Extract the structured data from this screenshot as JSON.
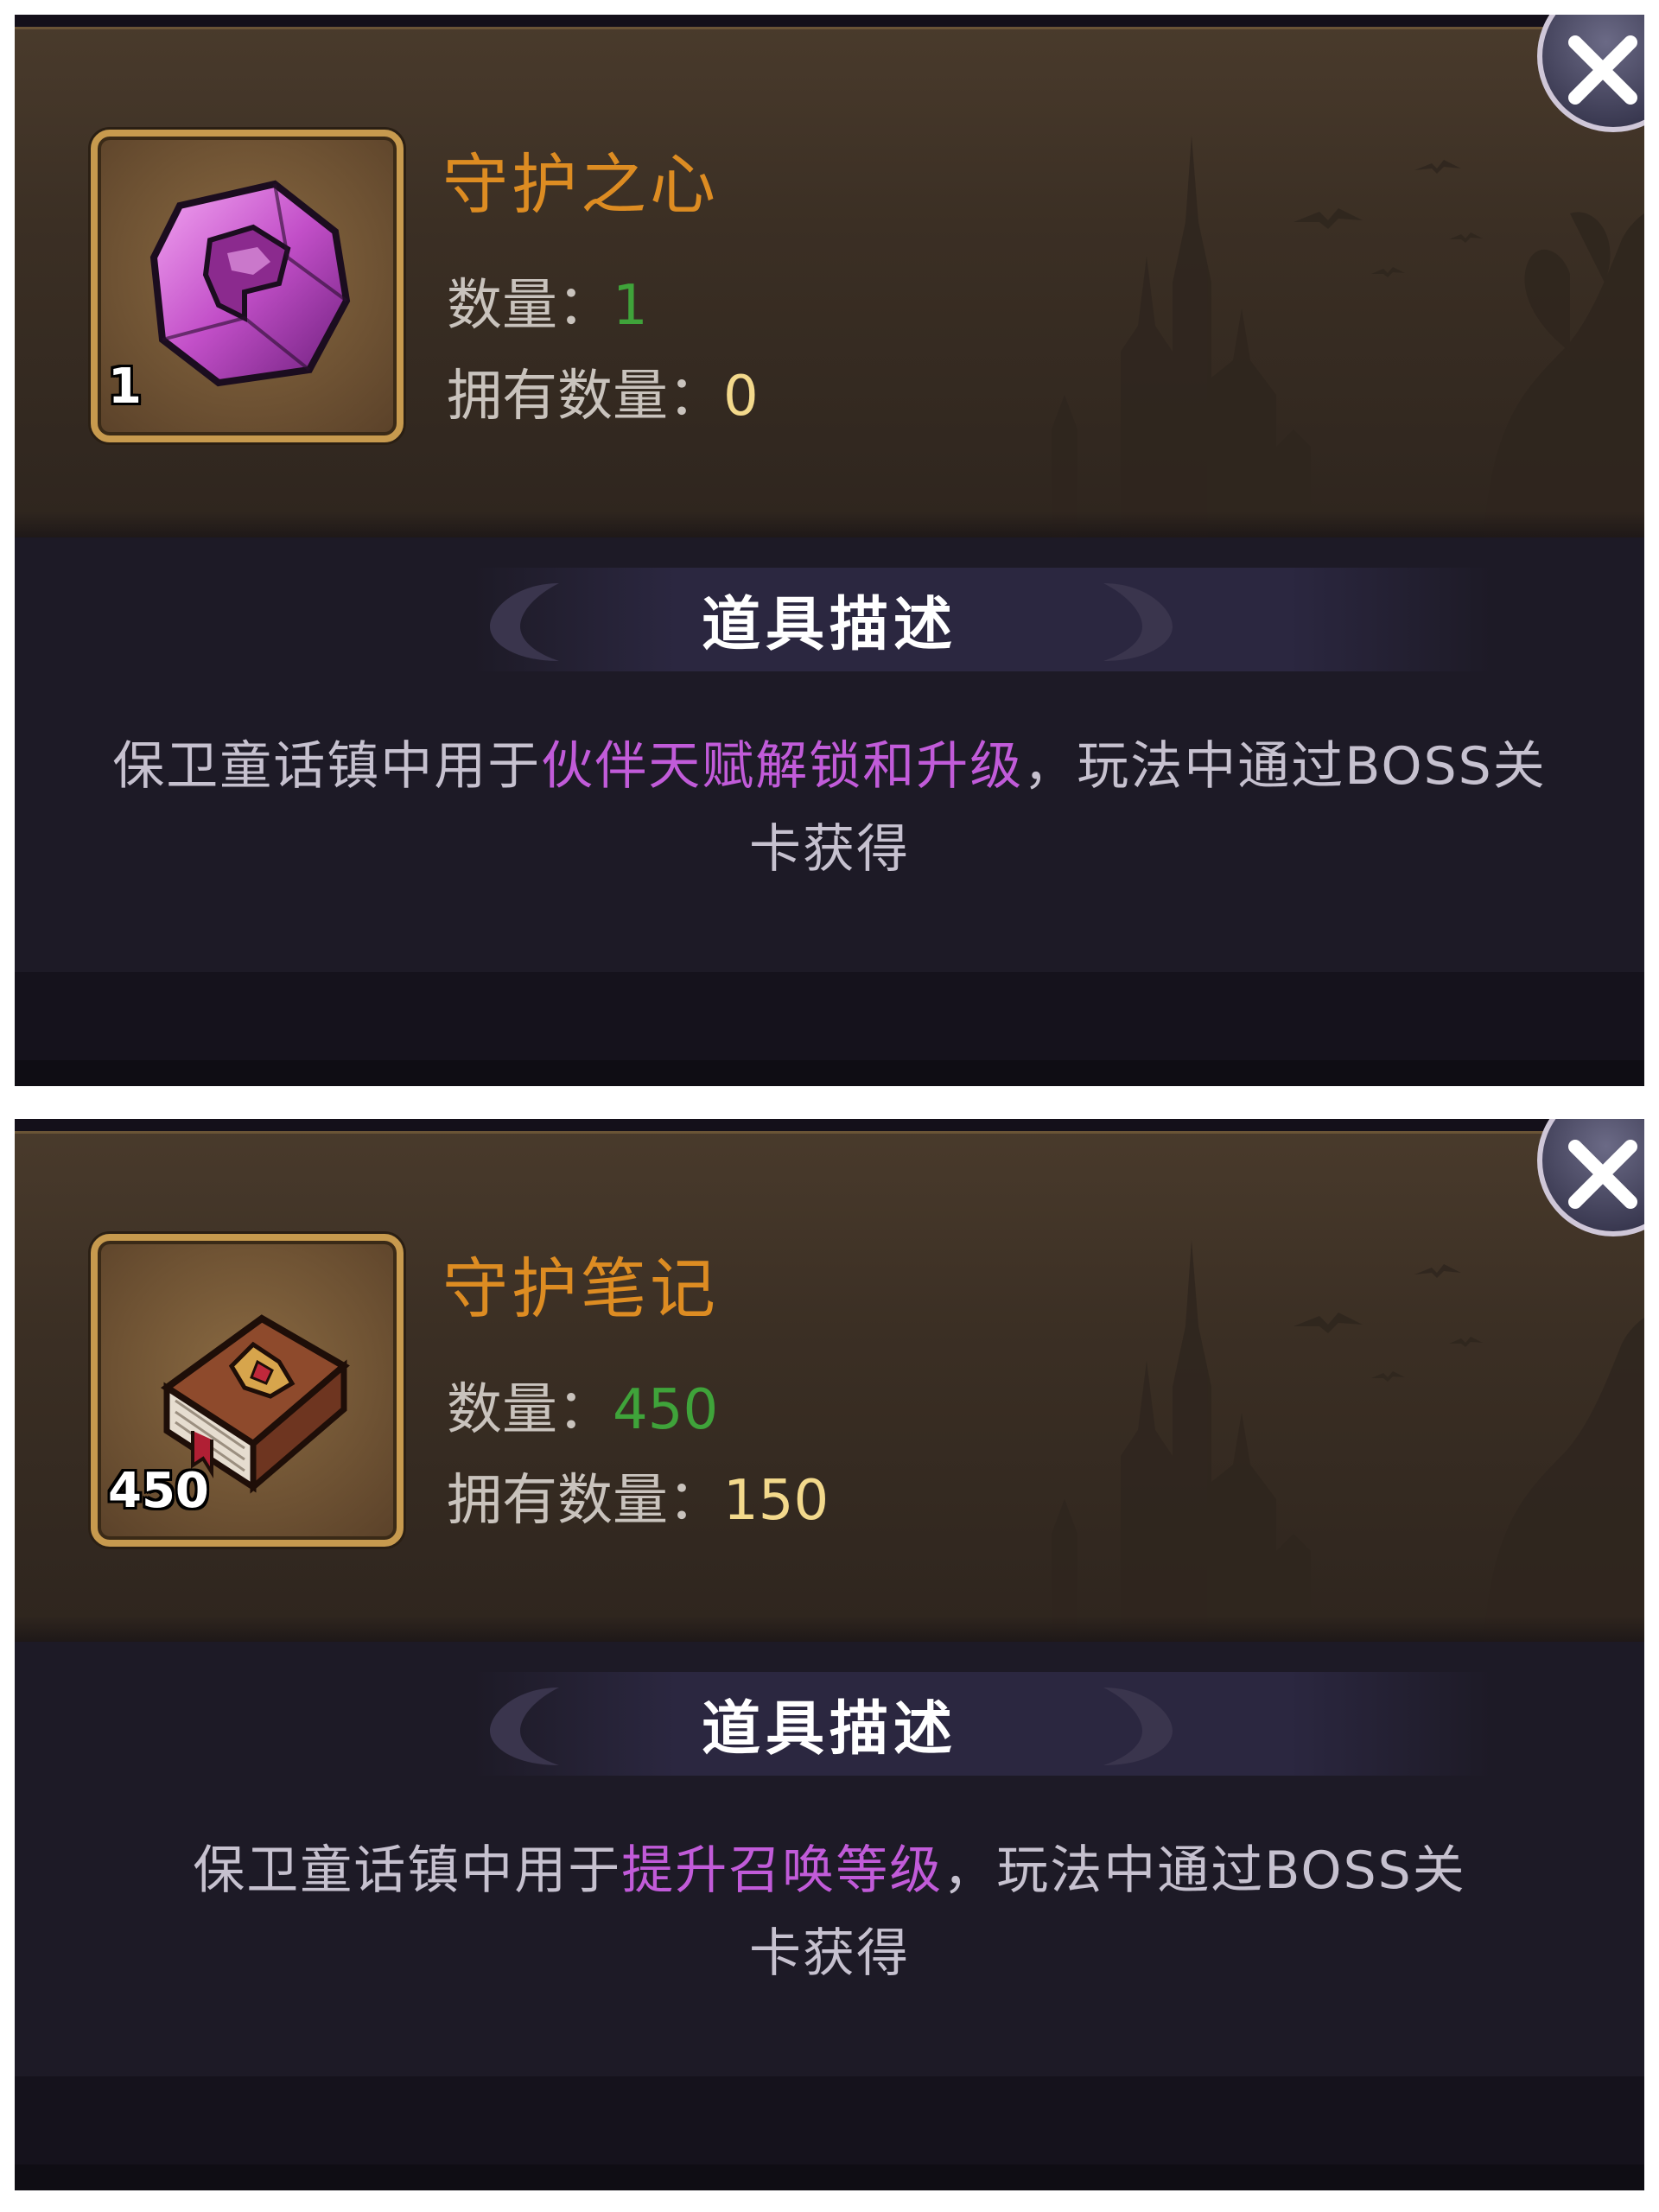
{
  "panels": [
    {
      "item_name": "守护之心",
      "icon": "pink-crystal-icon",
      "icon_qty": "1",
      "qty_label": "数量：",
      "qty_value": "1",
      "owned_label": "拥有数量：",
      "owned_value": "0",
      "desc_title": "道具描述",
      "desc_pre": "保卫童话镇中用于",
      "desc_highlight": "伙伴天赋解锁和升级",
      "desc_post": "，玩法中通过BOSS关卡获得"
    },
    {
      "item_name": "守护笔记",
      "icon": "guardian-book-icon",
      "icon_qty": "450",
      "qty_label": "数量：",
      "qty_value": "450",
      "owned_label": "拥有数量：",
      "owned_value": "150",
      "desc_title": "道具描述",
      "desc_pre": "保卫童话镇中用于",
      "desc_highlight": "提升召唤等级",
      "desc_post": "，玩法中通过BOSS关卡获得"
    }
  ],
  "colors": {
    "item_name": "#dd8c22",
    "qty_value": "#3fa33a",
    "owned_value": "#f3d98c",
    "highlight": "#c15bd9",
    "frame": "#c79a4e"
  }
}
